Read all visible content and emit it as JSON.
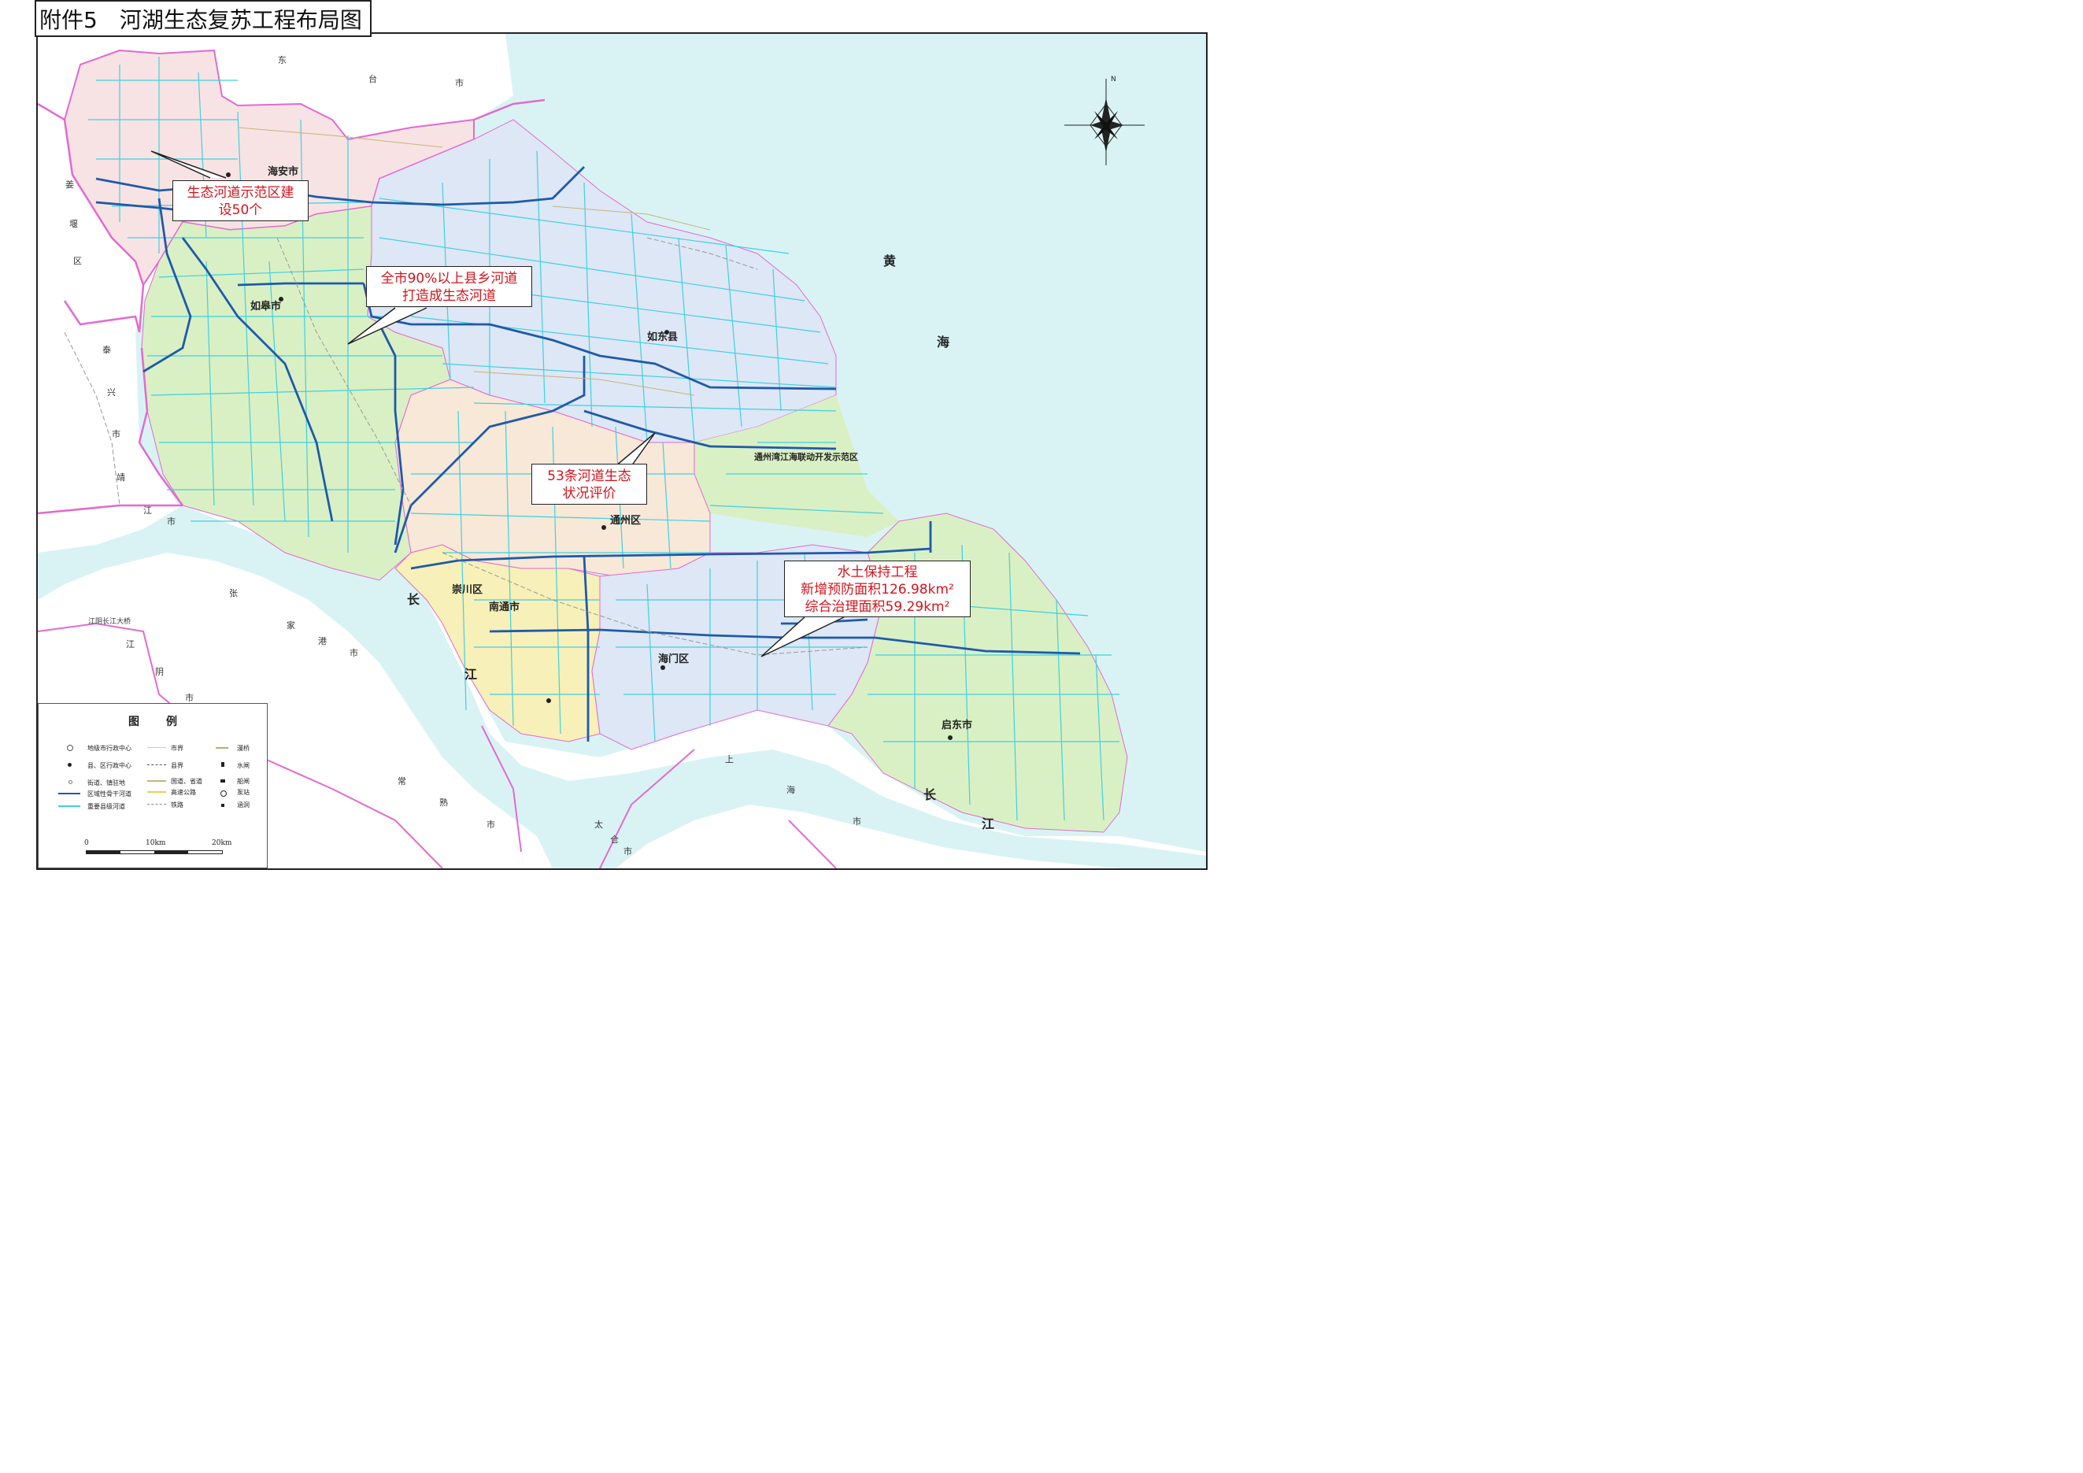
{
  "title": {
    "prefix": "附件5",
    "main": "河湖生态复苏工程布局图"
  },
  "callouts": {
    "demo_zone": [
      "生态河道示范区建",
      "设50个"
    ],
    "ecological_rivers": [
      "全市90%以上县乡河道",
      "打造成生态河道"
    ],
    "evaluation": [
      "53条河道生态",
      "状况评价"
    ],
    "soil_water": [
      "水土保持工程",
      "新增预防面积126.98km²",
      "综合治理面积59.29km²"
    ]
  },
  "cities": {
    "haian": "海安市",
    "rugao": "如皋市",
    "rudong": "如东县",
    "tongzhou": "通州区",
    "chongchuan": "崇川区",
    "nantong": "南通市",
    "haimen": "海门区",
    "qidong": "启东市",
    "tongzhou_bay": "通州湾江海联动开发示范区"
  },
  "seas": {
    "huanghai_1": "黄",
    "huanghai_2": "海",
    "changjiang_a1": "长",
    "changjiang_a2": "江",
    "changjiang_b1": "长",
    "changjiang_b2": "江"
  },
  "regions": {
    "dongtai": [
      "东",
      "台",
      "市"
    ],
    "jiangyan": [
      "姜",
      "堰",
      "区"
    ],
    "taixing": [
      "泰",
      "兴",
      "市"
    ],
    "jingjiang": [
      "靖",
      "江",
      "市"
    ],
    "zhangjiagang": [
      "张",
      "家",
      "港",
      "市"
    ],
    "jiangyin": [
      "江",
      "阴",
      "市"
    ],
    "changshu": [
      "常",
      "熟",
      "市"
    ],
    "taicang": [
      "太",
      "仓",
      "市"
    ],
    "shanghai": [
      "上",
      "海",
      "市"
    ]
  },
  "bridge_label": "江阴长江大桥",
  "compass_label": "N",
  "legend": {
    "title": "图例",
    "items": {
      "l1": "地级市行政中心",
      "l2": "县、区行政中心",
      "l3": "街道、镇驻地",
      "l4": "区域性骨干河道",
      "l5": "重要县级河道",
      "m1": "市界",
      "m2": "县界",
      "m3": "国道、省道",
      "m4": "高速公路",
      "m5": "铁路",
      "r1": "漫桥",
      "r2": "水闸",
      "r3": "船闸",
      "r4": "泵站",
      "r5": "涵洞"
    },
    "scale": [
      "0",
      "10km",
      "20km"
    ]
  },
  "colors": {
    "sea": "#d9f3f5",
    "outside": "#ffffff",
    "haian": "#f7e3e3",
    "rugao": "#d9f0c4",
    "rudong": "#dde7f5",
    "tongzhou": "#f7e8d8",
    "chongchuan": "#f7f0b8",
    "haimen": "#dde7f5",
    "qidong": "#d9f0c4",
    "trunk_river": "#1f5aa8",
    "county_river": "#3fd0e0",
    "city_boundary": "#e26ad0",
    "callout_text": "#d4141c"
  }
}
